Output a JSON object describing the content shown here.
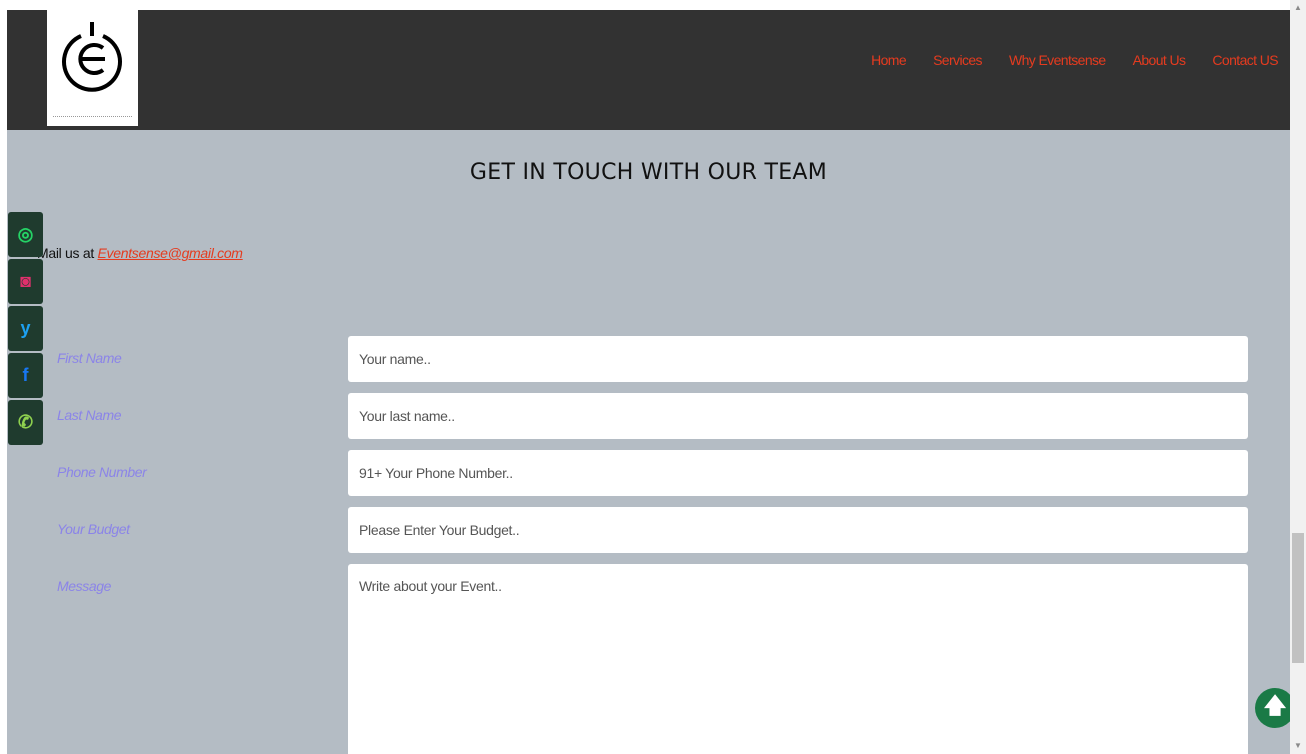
{
  "nav": {
    "links": [
      "Home",
      "Services",
      "Why Eventsense",
      "About Us",
      "Contact US"
    ]
  },
  "heading": "GET IN TOUCH WITH OUR TEAM",
  "mail": {
    "prefix": "Mail us at ",
    "email": "Eventsense@gmail.com"
  },
  "social": [
    {
      "icon": "whatsapp-icon",
      "glyph": "◎",
      "color": "#25d366"
    },
    {
      "icon": "instagram-icon",
      "glyph": "◙",
      "color": "#e1306c"
    },
    {
      "icon": "twitter-icon",
      "glyph": "y",
      "color": "#1da1f2"
    },
    {
      "icon": "facebook-icon",
      "glyph": "f",
      "color": "#1877f2"
    },
    {
      "icon": "phone-icon",
      "glyph": "✆",
      "color": "#8fd14f"
    }
  ],
  "form": {
    "first_name": {
      "label": "First Name",
      "placeholder": "Your name.."
    },
    "last_name": {
      "label": "Last Name",
      "placeholder": "Your last name.."
    },
    "phone": {
      "label": "Phone Number",
      "placeholder": "91+ Your Phone Number.."
    },
    "budget": {
      "label": "Your Budget",
      "placeholder": "Please Enter Your Budget.."
    },
    "message": {
      "label": "Message",
      "placeholder": "Write about your Event.."
    }
  },
  "colors": {
    "nav_bg": "#323232",
    "page_bg": "#b4bcc4",
    "nav_link": "#e53b1f",
    "label": "#8b84e8",
    "scroll_top": "#1a7a46"
  }
}
